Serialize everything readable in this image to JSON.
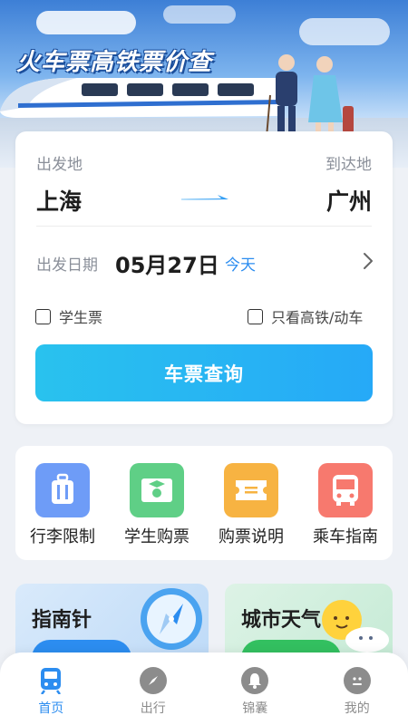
{
  "banner": {
    "title": "火车票高铁票价查"
  },
  "search": {
    "from_label": "出发地",
    "to_label": "到达地",
    "from_city": "上海",
    "to_city": "广州",
    "date_label": "出发日期",
    "date_value": "05月27日",
    "date_hint": "今天",
    "student_checkbox": "学生票",
    "highspeed_checkbox": "只看高铁/动车",
    "submit": "车票查询"
  },
  "shortcuts": [
    {
      "label": "行李限制",
      "icon": "luggage-icon",
      "color": "#6e9cf7"
    },
    {
      "label": "学生购票",
      "icon": "student-ticket-icon",
      "color": "#5fcf86"
    },
    {
      "label": "购票说明",
      "icon": "ticket-info-icon",
      "color": "#f7b342"
    },
    {
      "label": "乘车指南",
      "icon": "bus-guide-icon",
      "color": "#f7796e"
    }
  ],
  "features": {
    "compass": {
      "title": "指南针"
    },
    "weather": {
      "title": "城市天气"
    }
  },
  "tabs": [
    {
      "label": "首页",
      "icon": "home-train-icon",
      "active": true
    },
    {
      "label": "出行",
      "icon": "compass-icon",
      "active": false
    },
    {
      "label": "锦囊",
      "icon": "bell-icon",
      "active": false
    },
    {
      "label": "我的",
      "icon": "profile-icon",
      "active": false
    }
  ],
  "colors": {
    "accent": "#2c8df0",
    "button_start": "#29c2ee",
    "button_end": "#26a9f7"
  }
}
